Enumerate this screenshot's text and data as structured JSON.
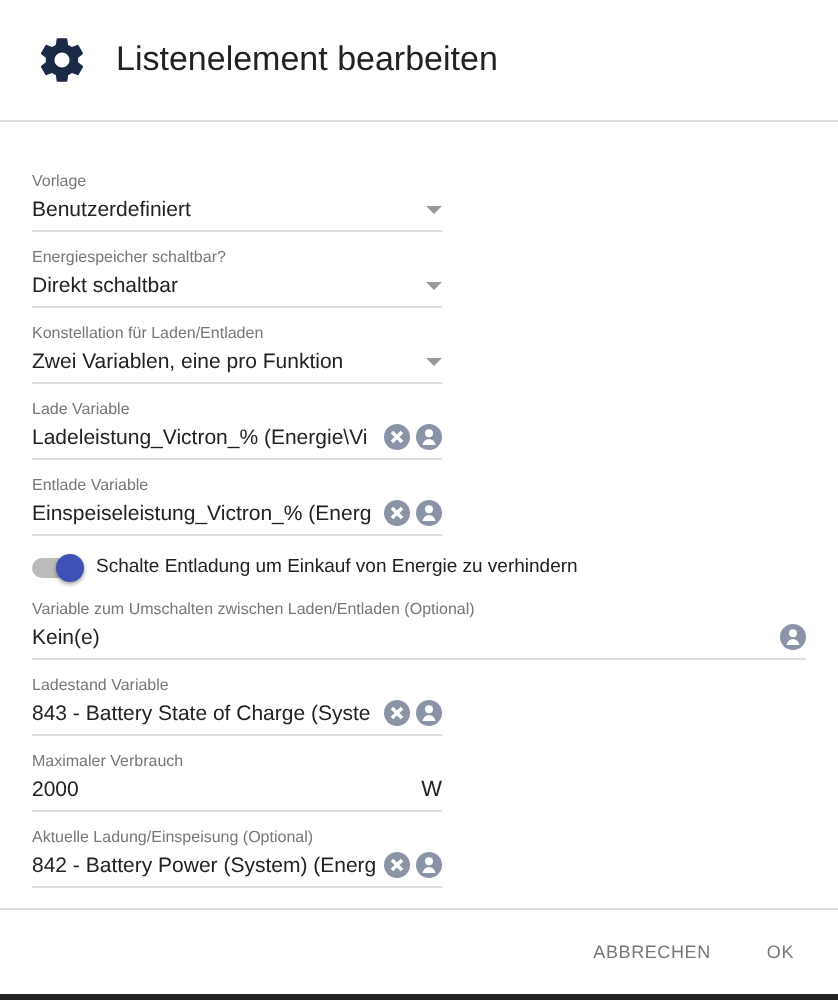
{
  "dialog": {
    "title": "Listenelement bearbeiten"
  },
  "fields": [
    {
      "kind": "select",
      "label": "Vorlage",
      "value": "Benutzerdefiniert"
    },
    {
      "kind": "select",
      "label": "Energiespeicher schaltbar?",
      "value": "Direkt schaltbar"
    },
    {
      "kind": "select",
      "label": "Konstellation für Laden/Entladen",
      "value": "Zwei Variablen, eine pro Funktion"
    },
    {
      "kind": "variable",
      "label": "Lade Variable",
      "value": "Ladeleistung_Victron_% (Energie\\Vi",
      "clearable": true
    },
    {
      "kind": "variable",
      "label": "Entlade Variable",
      "value": "Einspeiseleistung_Victron_% (Energ",
      "clearable": true
    },
    {
      "kind": "toggle",
      "label": "Schalte Entladung um Einkauf von Energie zu verhindern",
      "on": true
    },
    {
      "kind": "variable",
      "label": "Variable zum Umschalten zwischen Laden/Entladen (Optional)",
      "value": "Kein(e)",
      "clearable": false
    },
    {
      "kind": "variable",
      "label": "Ladestand Variable",
      "value": "843 - Battery State of Charge (Syste",
      "clearable": true
    },
    {
      "kind": "number",
      "label": "Maximaler Verbrauch",
      "value": "2000",
      "unit": "W"
    },
    {
      "kind": "variable",
      "label": "Aktuelle Ladung/Einspeisung (Optional)",
      "value": "842 - Battery Power (System) (Energ",
      "clearable": true
    }
  ],
  "buttons": [
    "ABBRECHEN",
    "OK"
  ]
}
